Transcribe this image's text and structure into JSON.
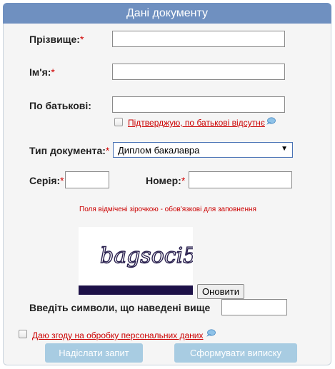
{
  "header": {
    "title": "Дані документу"
  },
  "form": {
    "surname_label": "Прізвище:",
    "name_label": "Ім'я:",
    "patronymic_label": "По батькові:",
    "no_patronymic_text": "Підтверджую, по батькові відсутнє",
    "doc_type_label": "Тип документа:",
    "doc_type_value": "Диплом бакалавра",
    "series_label": "Серія:",
    "number_label": "Номер:",
    "required_asterisk": "*",
    "required_note": "Поля відмічені зірочкою - обов'язкові для заповнення"
  },
  "captcha": {
    "text": "bagsoci5",
    "refresh_label": "Оновити",
    "prompt_label": "Введіть символи, що наведені вище"
  },
  "consent": {
    "text": "Даю згоду на обробку персональних даних"
  },
  "buttons": {
    "submit_label": "Надіслати запит",
    "generate_label": "Сформувати виписку"
  },
  "icons": {
    "help": "speech-bubble-icon",
    "dropdown": "chevron-down-icon"
  },
  "colors": {
    "header_bg": "#6f90c0",
    "required": "#cc0000",
    "button_bg": "#a8cce2",
    "captcha_bar": "#1d1148"
  }
}
